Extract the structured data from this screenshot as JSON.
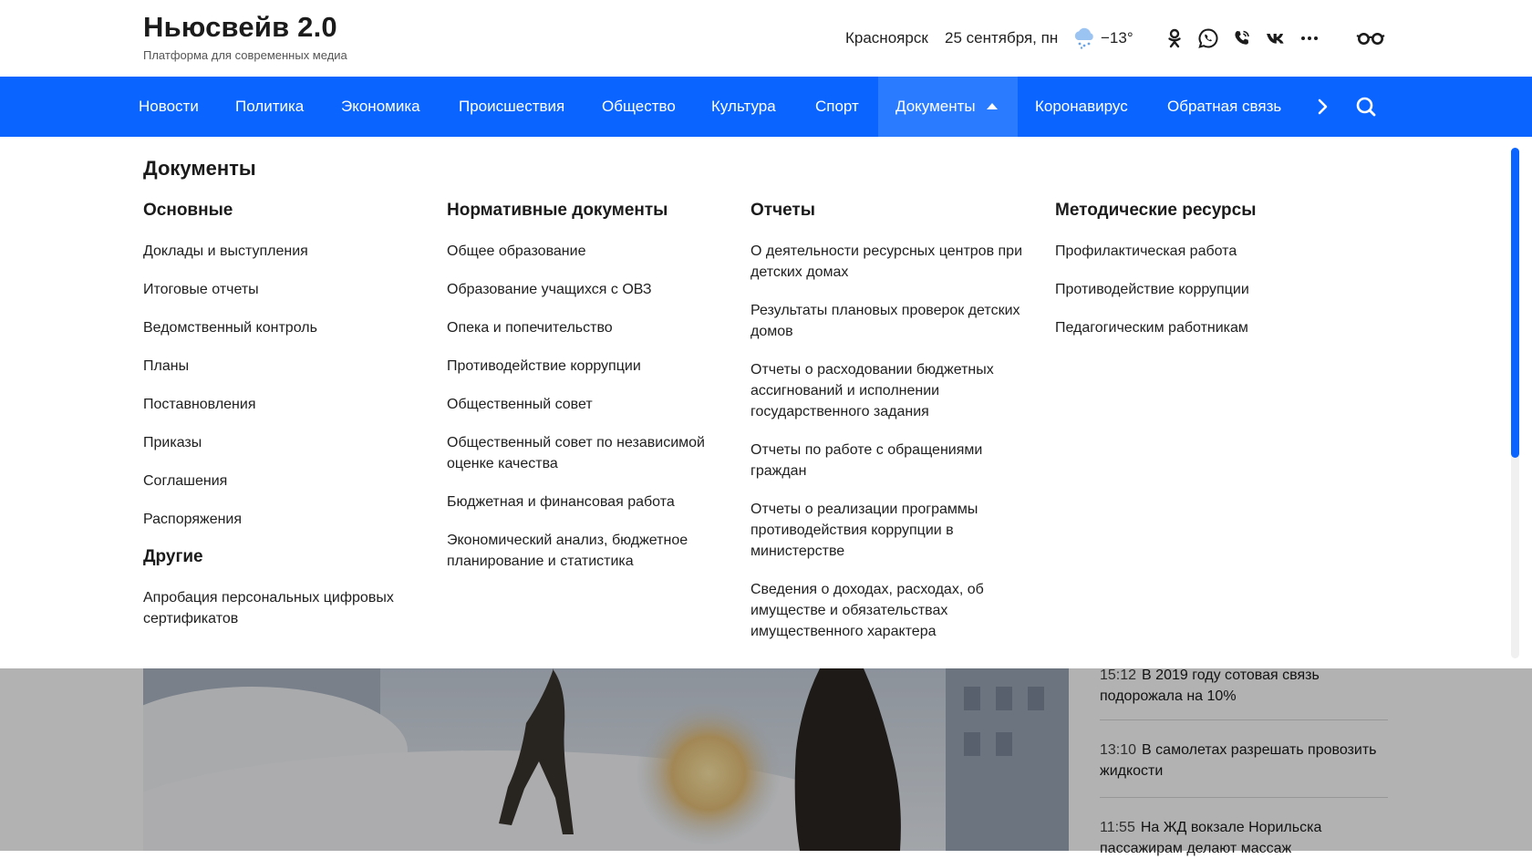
{
  "header": {
    "title": "Ньюсвейв 2.0",
    "subtitle": "Платформа для современных медиа",
    "city": "Красноярск",
    "date": "25 сентября, пн",
    "temperature": "−13°",
    "weather_icon": "snow-cloud-icon",
    "social_icons": [
      "odnoklassniki-icon",
      "whatsapp-icon",
      "viber-icon",
      "vk-icon",
      "more-dots-icon",
      "accessibility-glasses-icon"
    ]
  },
  "nav": {
    "items": [
      {
        "label": "Новости"
      },
      {
        "label": "Политика"
      },
      {
        "label": "Экономика"
      },
      {
        "label": "Происшествия"
      },
      {
        "label": "Общество"
      },
      {
        "label": "Культура"
      },
      {
        "label": "Спорт"
      },
      {
        "label": "Документы",
        "active": true
      },
      {
        "label": "Коронавирус"
      },
      {
        "label": "Обратная связь"
      }
    ],
    "next_icon": "chevron-right-icon",
    "search_icon": "search-icon",
    "accent_color": "#0a64ff"
  },
  "mega": {
    "title": "Документы",
    "columns": [
      {
        "heading": "Основные",
        "items": [
          "Доклады и выступления",
          "Итоговые отчеты",
          "Ведомственный контроль",
          "Планы",
          "Поставновления",
          "Приказы",
          "Соглашения",
          "Распоряжения"
        ],
        "heading2": "Другие",
        "items2": [
          "Апробация персональных цифровых сертификатов"
        ]
      },
      {
        "heading": "Нормативные документы",
        "items": [
          "Общее образование",
          "Образование учащихся с ОВЗ",
          "Опека и попечительство",
          "Противодействие коррупции",
          "Общественный совет",
          "Общественный совет по независимой оценке качества",
          "Бюджетная и финансовая работа",
          "Экономический анализ, бюджетное планирование и статистика"
        ]
      },
      {
        "heading": "Отчеты",
        "items": [
          "О деятельности ресурсных центров при детских домах",
          "Результаты плановых проверок детских домов",
          "Отчеты о расходовании бюджетных ассигнований и исполнении государственного задания",
          "Отчеты по работе с обращениями граждан",
          "Отчеты о реализации программы противодействия коррупции в министерстве",
          "Сведения о доходах, расходах, об имуществе и обязательствах имущественного характера"
        ]
      },
      {
        "heading": "Методические ресурсы",
        "items": [
          "Профилактическая работа",
          "Противодействие коррупции",
          "Педагогическим работникам"
        ]
      }
    ]
  },
  "feed": {
    "items": [
      {
        "time": "15:12",
        "text": "В 2019 году сотовая связь подорожала на 10%"
      },
      {
        "time": "13:10",
        "text": "В самолетах разрешать провозить жидкости"
      },
      {
        "time": "11:55",
        "text": "На ЖД вокзале Норильска пассажирам делают массаж"
      }
    ]
  }
}
